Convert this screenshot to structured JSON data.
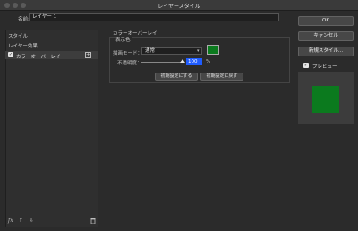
{
  "window": {
    "title": "レイヤースタイル"
  },
  "name_field": {
    "label": "名前:",
    "value": "レイヤー 1"
  },
  "sidebar": {
    "section_label": "スタイル",
    "layer_effects_label": "レイヤー効果",
    "selected_item": {
      "label": "カラーオーバーレイ",
      "checked": true,
      "add_icon": "plus-icon"
    },
    "bottom_icons": [
      "fx-icon",
      "arrow-up-icon",
      "arrow-down-icon",
      "trash-icon"
    ],
    "fx_text": "fx",
    "up_glyph": "⇧",
    "down_glyph": "⇩",
    "trash_glyph": "🗑"
  },
  "panel": {
    "title": "カラーオーバーレイ",
    "group_title": "表示色",
    "blend_mode": {
      "label": "描画モード：",
      "value": "通常"
    },
    "overlay_color": "#0b7a1e",
    "opacity": {
      "label": "不透明度：",
      "value": "100",
      "unit": "%"
    },
    "reset_default_button": "初期設定にする",
    "restore_default_button": "初期設定に戻す"
  },
  "right_buttons": {
    "ok": "OK",
    "cancel": "キャンセル",
    "new_style": "新規スタイル..."
  },
  "preview": {
    "label": "プレビュー",
    "checked": true
  }
}
